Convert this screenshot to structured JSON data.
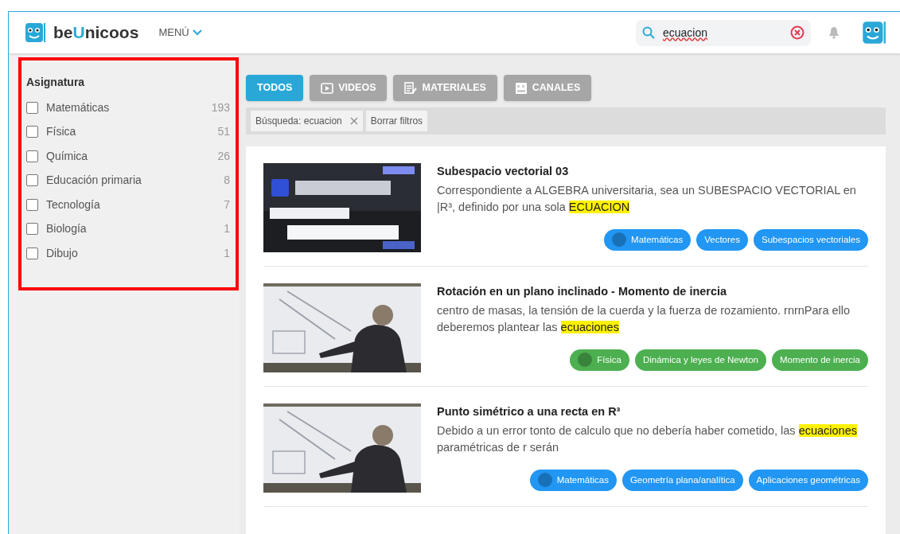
{
  "header": {
    "brand": "beUnicoos",
    "menu": "MENÚ",
    "search": {
      "value": "ecuacion"
    }
  },
  "sidebar": {
    "title": "Asignatura",
    "items": [
      {
        "label": "Matemáticas",
        "count": "193",
        "checked": false
      },
      {
        "label": "Física",
        "count": "51",
        "checked": false
      },
      {
        "label": "Química",
        "count": "26",
        "checked": false
      },
      {
        "label": "Educación primaria",
        "count": "8",
        "checked": false
      },
      {
        "label": "Tecnología",
        "count": "7",
        "checked": false
      },
      {
        "label": "Biología",
        "count": "1",
        "checked": false
      },
      {
        "label": "Dibujo",
        "count": "1",
        "checked": false
      }
    ]
  },
  "tabs": [
    {
      "label": "TODOS",
      "kind": "none",
      "selected": true
    },
    {
      "label": "VIDEOS",
      "kind": "video",
      "selected": false
    },
    {
      "label": "MATERIALES",
      "kind": "material",
      "selected": false
    },
    {
      "label": "CANALES",
      "kind": "channel",
      "selected": false
    }
  ],
  "filters": {
    "chip": "Búsqueda: ecuacion",
    "clear": "Borrar filtros"
  },
  "results": [
    {
      "title": "Subespacio vectorial 03",
      "text_before": "Correspondiente a ALGEBRA universitaria, sea un SUBESPACIO VECTORIAL en |R³, definido por una sola ",
      "highlight": "ECUACION",
      "color": "#2196f3",
      "tags": [
        "Matemáticas",
        "Vectores",
        "Subespacios vectoriales"
      ]
    },
    {
      "title": "Rotación en un plano inclinado - Momento de inercia",
      "text_before": "centro de masas, la tensión de la cuerda y la fuerza de rozamiento. rnrnPara ello deberemos plantear las ",
      "highlight": "ecuaciones",
      "color": "#4caf50",
      "tags": [
        "Física",
        "Dinámica y leyes de Newton",
        "Momento de inercia"
      ]
    },
    {
      "title": "Punto simétrico a una recta en R³",
      "text_before": "Debido a un error tonto de calculo que no debería haber cometido, las ",
      "highlight": "ecuaciones",
      "text_after": " paramétricas de r serán",
      "color": "#2196f3",
      "tags": [
        "Matemáticas",
        "Geometría plana/analítica",
        "Aplicaciones geométricas"
      ]
    }
  ]
}
